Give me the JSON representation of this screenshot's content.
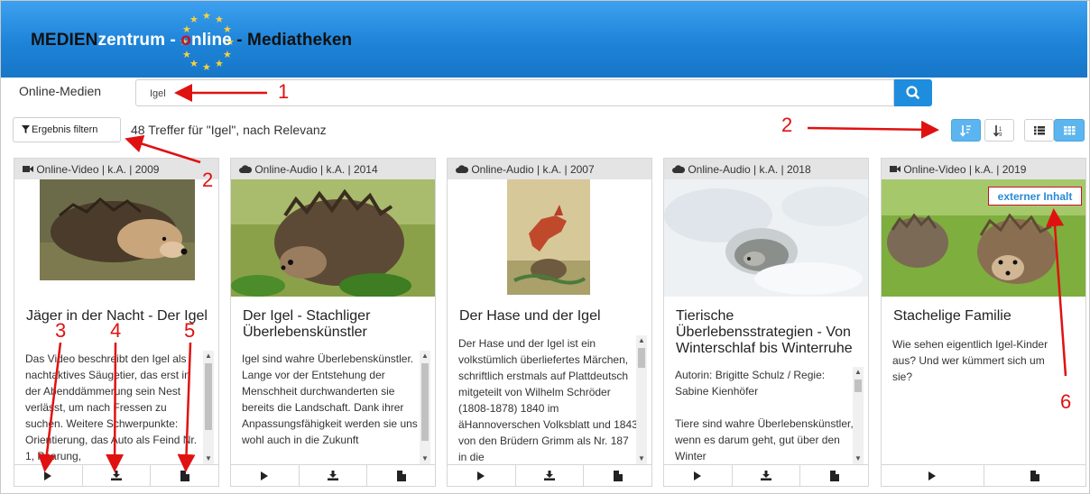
{
  "header": {
    "brand_part1": "MEDIEN",
    "brand_part2": "zentrum",
    "brand_sep1": " - ",
    "brand_o": "o",
    "brand_part3": "nline",
    "brand_sep2": " - ",
    "brand_part4": "Mediatheken",
    "colors": {
      "brand_blue": "#1f8ddd",
      "accent_red": "#c8102e",
      "star_yellow": "#f6d33c"
    }
  },
  "search": {
    "label": "Online-Medien",
    "value": "Igel",
    "button_icon": "search-icon"
  },
  "toolbar": {
    "filter_label": "Ergebnis filtern",
    "filter_icon": "funnel-icon",
    "result_text": "48 Treffer für \"Igel\", nach Relevanz",
    "view_buttons": [
      {
        "icon": "sort-relevance-icon",
        "active": true
      },
      {
        "icon": "sort-numeric-icon",
        "active": false
      },
      {
        "icon": "list-view-icon",
        "active": false
      },
      {
        "icon": "grid-view-icon",
        "active": true
      }
    ]
  },
  "cards": [
    {
      "type_icon": "video-camera-icon",
      "meta": "Online-Video | k.A. | 2009",
      "title": "Jäger in der Nacht - Der Igel",
      "description": "Das Video beschreibt den Igel als nachtaktives Säugetier, das erst in der Abenddämmerung sein Nest verlässt, um nach Fressen zu suchen. Weitere Schwerpunkte: Orientierung, das Auto als Feind Nr. 1, Paarung,",
      "actions": [
        "play-icon",
        "download-icon",
        "document-icon"
      ]
    },
    {
      "type_icon": "cloud-icon",
      "meta": "Online-Audio | k.A. | 2014",
      "title": "Der Igel - Stachliger Überlebenskünstler",
      "description": "Igel sind wahre Überlebenskünstler. Lange vor der Entstehung der Menschheit durchwanderten sie bereits die Landschaft. Dank ihrer Anpassungsfähigkeit werden sie uns wohl auch in die Zukunft",
      "actions": [
        "play-icon",
        "download-icon",
        "document-icon"
      ]
    },
    {
      "type_icon": "cloud-icon",
      "meta": "Online-Audio | k.A. | 2007",
      "title": "Der Hase und der Igel",
      "description": "Der Hase und der Igel ist ein volkstümlich überliefertes Märchen, schriftlich erstmals auf Plattdeutsch mitgeteilt von Wilhelm Schröder (1808-1878) 1840 im äHannoverschen Volksblatt und 1843 von den Brüdern Grimm als Nr. 187 in die",
      "actions": [
        "play-icon",
        "download-icon",
        "document-icon"
      ]
    },
    {
      "type_icon": "cloud-icon",
      "meta": "Online-Audio | k.A. | 2018",
      "title": "Tierische Überlebensstrategien - Von Winterschlaf bis Winterruhe",
      "description": "Autorin: Brigitte Schulz / Regie: Sabine Kienhöfer\n\nTiere sind wahre Überlebenskünstler, wenn es darum geht, gut über den Winter",
      "actions": [
        "play-icon",
        "download-icon",
        "document-icon"
      ]
    },
    {
      "type_icon": "video-camera-icon",
      "meta": "Online-Video | k.A. | 2019",
      "title": "Stachelige Familie",
      "description": "Wie sehen eigentlich Igel-Kinder aus? Und wer kümmert sich um sie?",
      "badge": "externer Inhalt",
      "actions": [
        "play-icon",
        "document-icon"
      ]
    }
  ],
  "annotations": [
    "1",
    "2",
    "2",
    "3",
    "4",
    "5",
    "6"
  ]
}
